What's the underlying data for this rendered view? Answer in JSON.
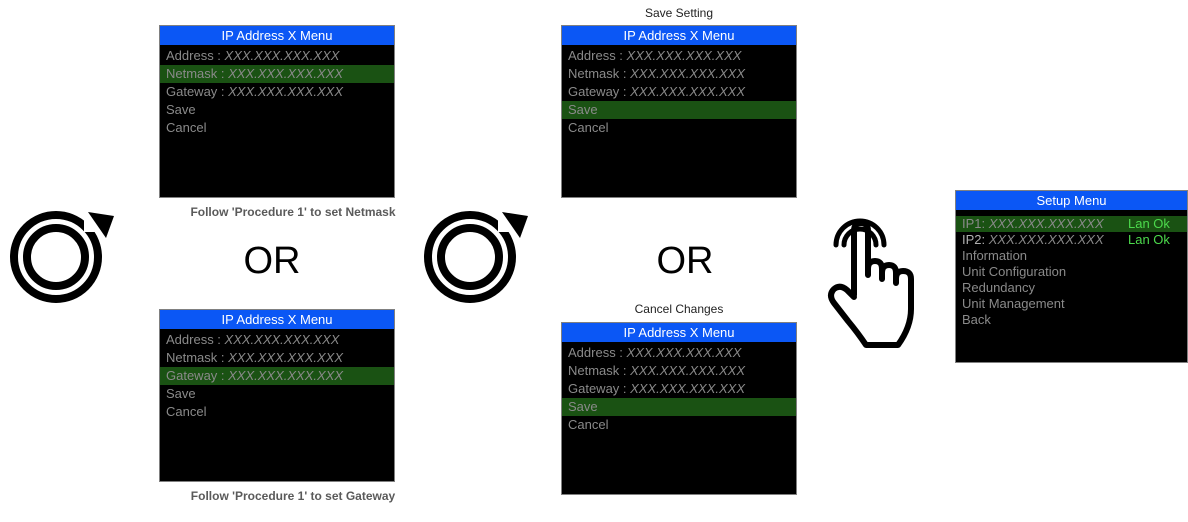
{
  "screens": {
    "netmask": {
      "title": "IP Address X Menu",
      "items": [
        {
          "label": "Address  : ",
          "value": "XXX.XXX.XXX.XXX"
        },
        {
          "label": "Netmask : ",
          "value": "XXX.XXX.XXX.XXX"
        },
        {
          "label": "Gateway : ",
          "value": "XXX.XXX.XXX.XXX"
        },
        {
          "label": "Save",
          "value": ""
        },
        {
          "label": "Cancel",
          "value": ""
        }
      ]
    },
    "gateway": {
      "title": "IP Address X Menu",
      "items": [
        {
          "label": "Address  : ",
          "value": "XXX.XXX.XXX.XXX"
        },
        {
          "label": "Netmask : ",
          "value": "XXX.XXX.XXX.XXX"
        },
        {
          "label": "Gateway : ",
          "value": "XXX.XXX.XXX.XXX"
        },
        {
          "label": "Save",
          "value": ""
        },
        {
          "label": "Cancel",
          "value": ""
        }
      ]
    },
    "save": {
      "label": "Save Setting",
      "title": "IP Address X Menu",
      "items": [
        {
          "label": "Address  : ",
          "value": "XXX.XXX.XXX.XXX"
        },
        {
          "label": "Netmask : ",
          "value": "XXX.XXX.XXX.XXX"
        },
        {
          "label": "Gateway : ",
          "value": "XXX.XXX.XXX.XXX"
        },
        {
          "label": "Save",
          "value": ""
        },
        {
          "label": "Cancel",
          "value": ""
        }
      ]
    },
    "cancel": {
      "label": "Cancel Changes",
      "title": "IP Address X Menu",
      "items": [
        {
          "label": "Address  : ",
          "value": "XXX.XXX.XXX.XXX"
        },
        {
          "label": "Netmask : ",
          "value": "XXX.XXX.XXX.XXX"
        },
        {
          "label": "Gateway : ",
          "value": "XXX.XXX.XXX.XXX"
        },
        {
          "label": "Save",
          "value": ""
        },
        {
          "label": "Cancel",
          "value": ""
        }
      ]
    },
    "setup": {
      "title": "Setup Menu",
      "items": [
        {
          "label": "IP1: ",
          "value": "XXX.XXX.XXX.XXX",
          "status": "Lan Ok"
        },
        {
          "label": "IP2: ",
          "value": "XXX.XXX.XXX.XXX",
          "status": "Lan Ok"
        },
        {
          "label": "Information"
        },
        {
          "label": "Unit Configuration"
        },
        {
          "label": "Redundancy"
        },
        {
          "label": "Unit Management"
        },
        {
          "label": "Back"
        }
      ]
    }
  },
  "captions": {
    "netmask": "Follow 'Procedure 1' to set Netmask",
    "gateway": "Follow 'Procedure 1' to set Gateway"
  },
  "or_text": "OR",
  "icons": {
    "rotate": "rotate-knob-icon",
    "press": "press-finger-icon"
  },
  "colors": {
    "title_bar": "#0b57f5",
    "selected_row": "#1a5213",
    "menu_text": "#8a8a8a",
    "status_text": "#4cd94c"
  }
}
